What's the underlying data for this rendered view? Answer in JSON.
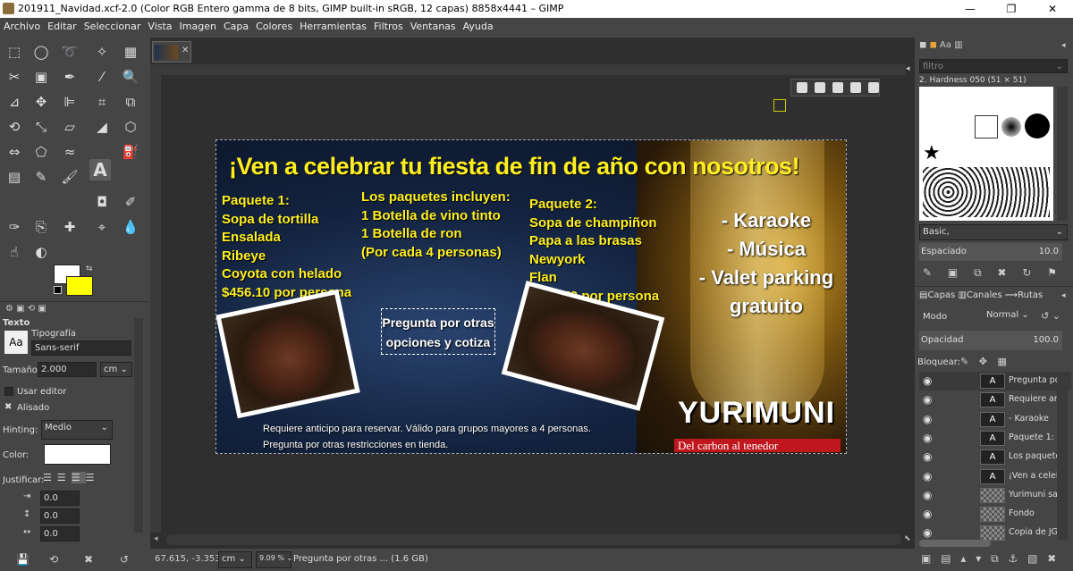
{
  "window": {
    "title": "201911_Navidad.xcf-2.0 (Color RGB Entero gamma de 8 bits, GIMP built-in sRGB, 12 capas) 8858x4441 – GIMP"
  },
  "menu": [
    "Archivo",
    "Editar",
    "Seleccionar",
    "Vista",
    "Imagen",
    "Capa",
    "Colores",
    "Herramientas",
    "Filtros",
    "Ventanas",
    "Ayuda"
  ],
  "tool_options": {
    "title": "Texto",
    "font_label": "Tipografía",
    "font_value": "Sans-serif",
    "size_label": "Tamaño:",
    "size_value": "2.000",
    "size_unit": "cm",
    "use_editor": "Usar editor",
    "antialias": "Alisado",
    "hinting_label": "Hinting:",
    "hinting_value": "Medio",
    "color_label": "Color:",
    "justify_label": "Justificar:",
    "indent_value": "0.0",
    "line_spacing_value": "0.0",
    "letter_spacing_value": "0.0",
    "aa_label": "Aa"
  },
  "status": {
    "coords": "67.615, -3.353",
    "unit": "cm",
    "zoom": "9.09 %",
    "message": "Pregunta por otras ... (1.6 GB)"
  },
  "banner": {
    "headline": "¡Ven a celebrar tu fiesta de fin de año con nosotros!",
    "pkg1": [
      "Paquete 1:",
      "Sopa de tortilla",
      "Ensalada",
      "Ribeye",
      "Coyota con helado",
      "$456.10 por persona"
    ],
    "includes": [
      "Los paquetes incluyen:",
      "1 Botella de vino tinto",
      "1 Botella de ron",
      "(Por cada 4 personas)"
    ],
    "pkg2": [
      "Paquete 2:",
      "Sopa de champiñon",
      "Papa a las brasas",
      "Newyork",
      "Flan",
      "$347.50 por persona"
    ],
    "extras": [
      "- Karaoke",
      "- Música",
      "- Valet parking",
      "gratuito"
    ],
    "ask": [
      "Pregunta por otras",
      "opciones y cotiza"
    ],
    "footnote": [
      "Requiere anticipo para reservar. Válido para grupos mayores a 4 personas.",
      "Pregunta por otras restricciones en tienda."
    ],
    "brand": "YURIMUNI",
    "tagline": "Del carbon al tenedor"
  },
  "brushes": {
    "filter_placeholder": "filtro",
    "current": "2. Hardness 050 (51 × 51)",
    "preset": "Basic,",
    "spacing_label": "Espaciado",
    "spacing_value": "10.0"
  },
  "layers_panel": {
    "tabs": [
      "Capas",
      "Canales",
      "Rutas"
    ],
    "mode_label": "Modo",
    "mode_value": "Normal",
    "opacity_label": "Opacidad",
    "opacity_value": "100.0",
    "lock_label": "Bloquear:",
    "layers": [
      {
        "name": "Pregunta por",
        "text": true
      },
      {
        "name": "Requiere ant",
        "text": true
      },
      {
        "name": "- Karaoke",
        "text": true
      },
      {
        "name": "Paquete 1:",
        "text": true
      },
      {
        "name": "Los paquetes",
        "text": true
      },
      {
        "name": "¡Ven a celebr",
        "text": true
      },
      {
        "name": "Yurimuni salic",
        "text": false
      },
      {
        "name": "Fondo",
        "text": false
      },
      {
        "name": "Copia de JGS",
        "text": false
      }
    ]
  }
}
